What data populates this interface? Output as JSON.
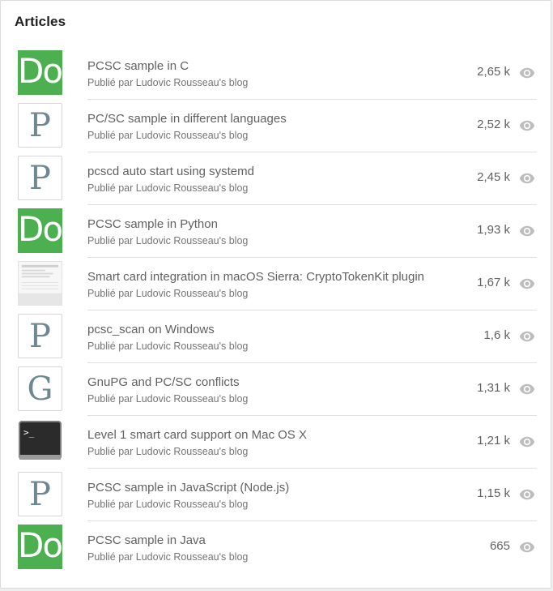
{
  "card": {
    "title": "Articles"
  },
  "articles": [
    {
      "title": "PCSC sample in C",
      "byline": "Publié par Ludovic Rousseau's blog",
      "views": "2,65 k",
      "thumb": "green",
      "thumb_text": "Dor"
    },
    {
      "title": "PC/SC sample in different languages",
      "byline": "Publié par Ludovic Rousseau's blog",
      "views": "2,52 k",
      "thumb": "letter",
      "thumb_text": "P"
    },
    {
      "title": "pcscd auto start using systemd",
      "byline": "Publié par Ludovic Rousseau's blog",
      "views": "2,45 k",
      "thumb": "letter",
      "thumb_text": "P"
    },
    {
      "title": "PCSC sample in Python",
      "byline": "Publié par Ludovic Rousseau's blog",
      "views": "1,93 k",
      "thumb": "green",
      "thumb_text": "Dor"
    },
    {
      "title": "Smart card integration in macOS Sierra: CryptoTokenKit plugin",
      "byline": "Publié par Ludovic Rousseau's blog",
      "views": "1,67 k",
      "thumb": "shot",
      "thumb_text": ""
    },
    {
      "title": "pcsc_scan on Windows",
      "byline": "Publié par Ludovic Rousseau's blog",
      "views": "1,6 k",
      "thumb": "letter",
      "thumb_text": "P"
    },
    {
      "title": "GnuPG and PC/SC conflicts",
      "byline": "Publié par Ludovic Rousseau's blog",
      "views": "1,31 k",
      "thumb": "letter",
      "thumb_text": "G"
    },
    {
      "title": "Level 1 smart card support on Mac OS X",
      "byline": "Publié par Ludovic Rousseau's blog",
      "views": "1,21 k",
      "thumb": "terminal",
      "thumb_text": ""
    },
    {
      "title": "PCSC sample in JavaScript (Node.js)",
      "byline": "Publié par Ludovic Rousseau's blog",
      "views": "1,15 k",
      "thumb": "letter",
      "thumb_text": "P"
    },
    {
      "title": "PCSC sample in Java",
      "byline": "Publié par Ludovic Rousseau's blog",
      "views": "665",
      "thumb": "green",
      "thumb_text": "Dor"
    }
  ],
  "icons": {
    "views": "eye-icon"
  },
  "colors": {
    "thumb_green": "#4caf50",
    "eye": "#bdbdbd"
  }
}
